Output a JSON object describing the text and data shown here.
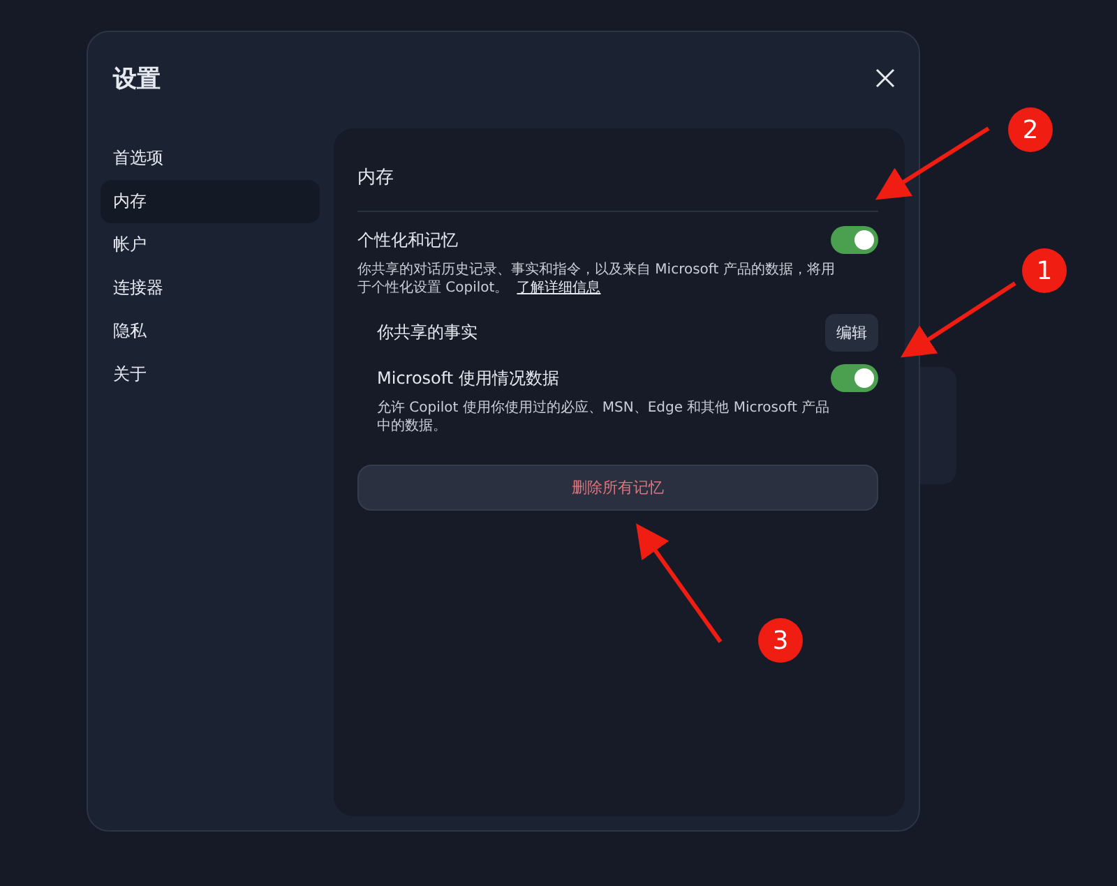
{
  "dialog": {
    "title": "设置"
  },
  "sidebar": {
    "items": [
      {
        "label": "首选项",
        "selected": false
      },
      {
        "label": "内存",
        "selected": true
      },
      {
        "label": "帐户",
        "selected": false
      },
      {
        "label": "连接器",
        "selected": false
      },
      {
        "label": "隐私",
        "selected": false
      },
      {
        "label": "关于",
        "selected": false
      }
    ]
  },
  "panel": {
    "title": "内存",
    "personalization": {
      "label": "个性化和记忆",
      "on": true,
      "description": "你共享的对话历史记录、事实和指令，以及来自 Microsoft 产品的数据，将用于个性化设置 Copilot。",
      "link": "了解详细信息"
    },
    "facts": {
      "label": "你共享的事实",
      "button": "编辑"
    },
    "usage": {
      "label": "Microsoft 使用情况数据",
      "on": true,
      "description": "允许 Copilot 使用你使用过的必应、MSN、Edge 和其他 Microsoft 产品中的数据。"
    },
    "delete_button": "删除所有记忆"
  },
  "annotations": [
    {
      "label": "2"
    },
    {
      "label": "1"
    },
    {
      "label": "3"
    }
  ]
}
